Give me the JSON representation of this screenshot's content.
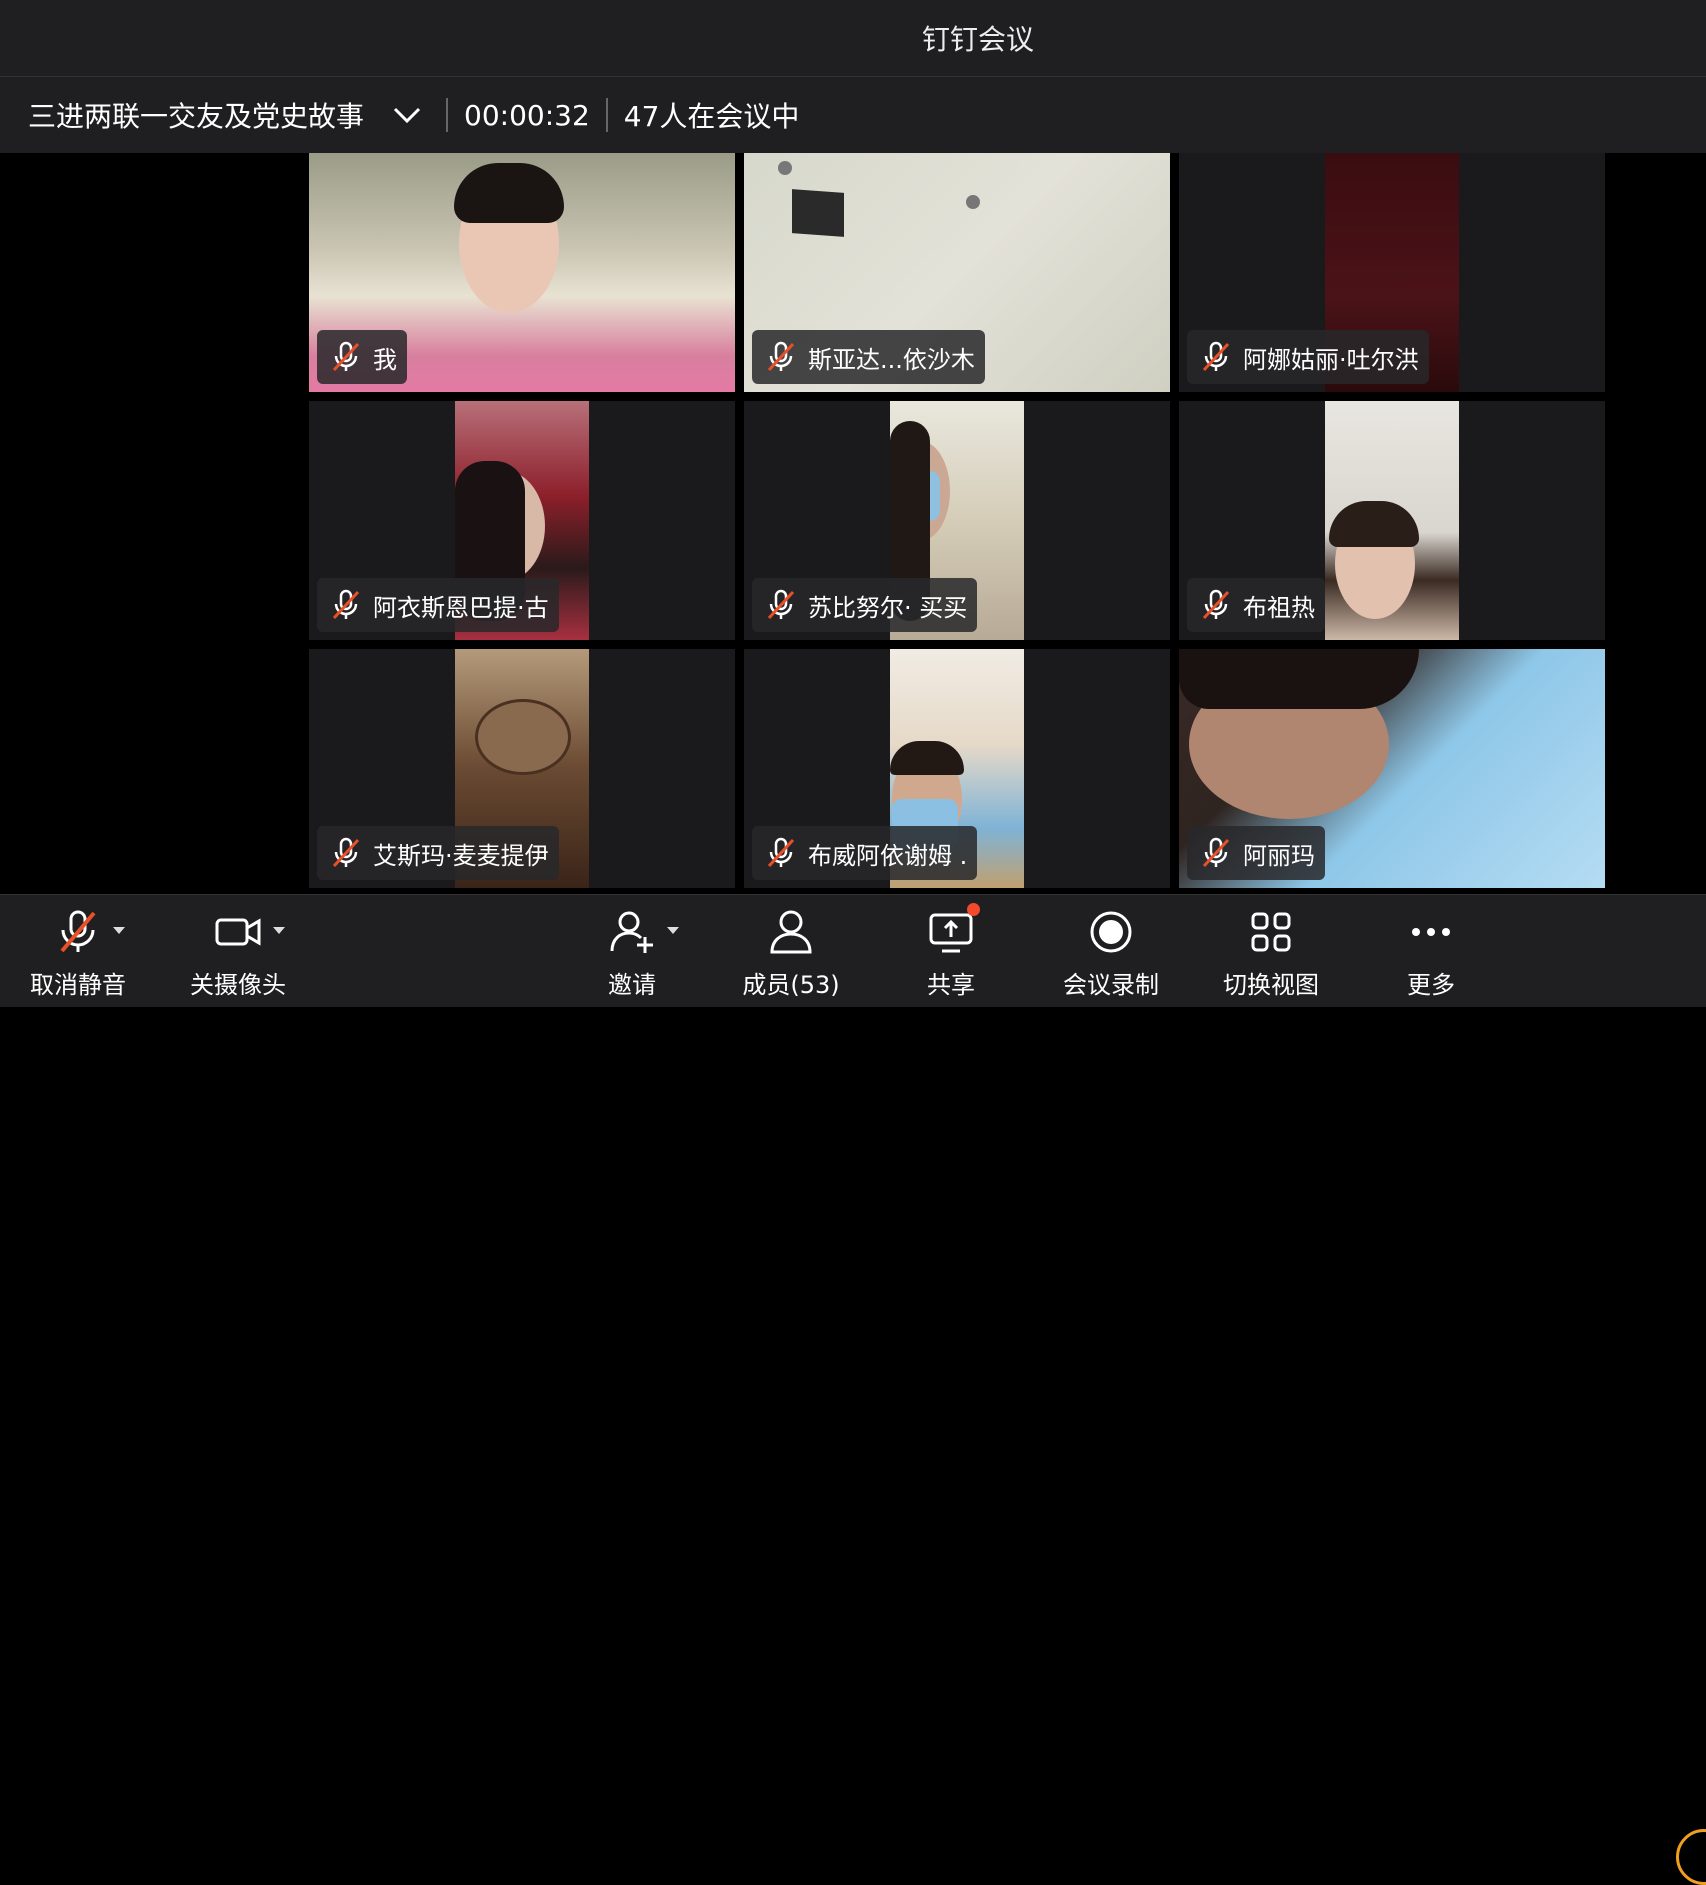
{
  "window": {
    "title": "钉钉会议"
  },
  "meeting": {
    "name": "三进两联一交友及党史故事",
    "timer": "00:00:32",
    "participants_in_meeting": "47人在会议中"
  },
  "tiles": [
    {
      "name": "我",
      "muted": true
    },
    {
      "name": "斯亚达...依沙木",
      "muted": true
    },
    {
      "name": "阿娜姑丽·吐尔洪",
      "muted": true
    },
    {
      "name": "阿衣斯恩巴提·古",
      "muted": true
    },
    {
      "name": "苏比努尔· 买买",
      "muted": true
    },
    {
      "name": "布祖热",
      "muted": true
    },
    {
      "name": "艾斯玛·麦麦提伊",
      "muted": true
    },
    {
      "name": "布威阿依谢姆 .",
      "muted": true
    },
    {
      "name": "阿丽玛",
      "muted": true
    }
  ],
  "toolbar": {
    "unmute": "取消静音",
    "camera_off": "关摄像头",
    "invite": "邀请",
    "members": "成员(53)",
    "share": "共享",
    "record": "会议录制",
    "switch_view": "切换视图",
    "more": "更多"
  },
  "colors": {
    "mute_slash": "#e8502a",
    "accent_dot": "#f24a2a",
    "bar_bg": "#1f1f21"
  },
  "icons": [
    "chevron-down-icon",
    "mic-muted-icon",
    "camera-icon",
    "add-user-icon",
    "members-icon",
    "share-screen-icon",
    "record-icon",
    "grid-view-icon",
    "more-icon"
  ]
}
